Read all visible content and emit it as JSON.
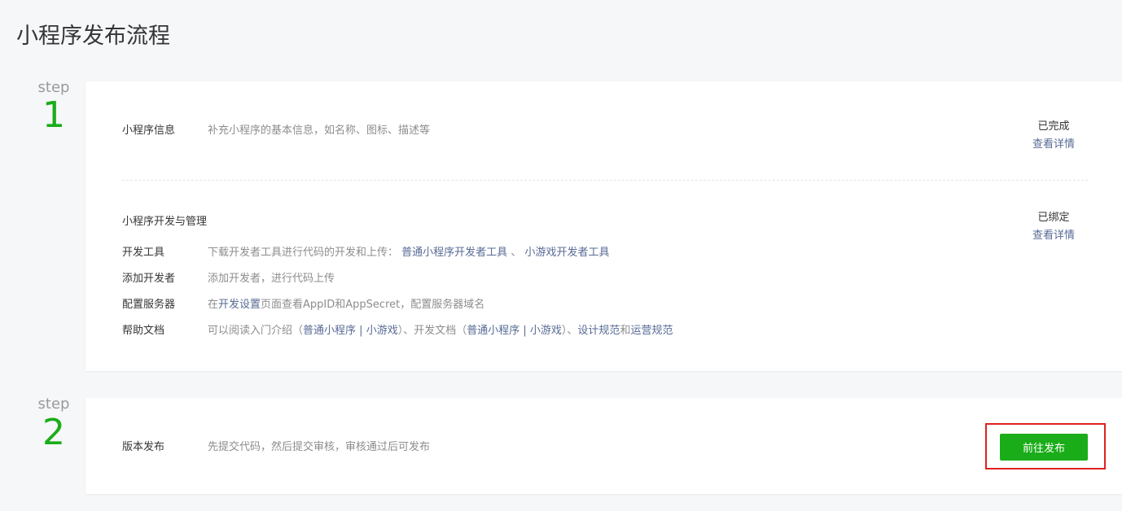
{
  "page": {
    "title": "小程序发布流程"
  },
  "steps": [
    {
      "label": "step",
      "number": "1"
    },
    {
      "label": "step",
      "number": "2"
    }
  ],
  "step1": {
    "info": {
      "label": "小程序信息",
      "desc": "补充小程序的基本信息，如名称、图标、描述等",
      "status": "已完成",
      "detail_link": "查看详情"
    },
    "dev": {
      "heading": "小程序开发与管理",
      "status": "已绑定",
      "detail_link": "查看详情",
      "rows": {
        "tools": {
          "label": "开发工具",
          "desc": "下载开发者工具进行代码的开发和上传：",
          "link1": "普通小程序开发者工具",
          "sep": "、",
          "link2": "小游戏开发者工具"
        },
        "add_dev": {
          "label": "添加开发者",
          "desc": "添加开发者，进行代码上传"
        },
        "server": {
          "label": "配置服务器",
          "pre": "在",
          "link": "开发设置",
          "post": "页面查看AppID和AppSecret，配置服务器域名"
        },
        "docs": {
          "label": "帮助文档",
          "t1": "可以阅读入门介绍（",
          "l1": "普通小程序",
          "t2": " | ",
          "l2": "小游戏",
          "t3": "）、开发文档（",
          "l3": "普通小程序",
          "t4": " | ",
          "l4": "小游戏",
          "t5": "）、",
          "l5": "设计规范",
          "t6": "和",
          "l6": "运营规范"
        }
      }
    }
  },
  "step2": {
    "label": "版本发布",
    "desc": "先提交代码，然后提交审核，审核通过后可发布",
    "button": "前往发布"
  },
  "colors": {
    "accent_green": "#1aad19",
    "link_blue": "#576b95",
    "highlight_red": "#e02020"
  }
}
